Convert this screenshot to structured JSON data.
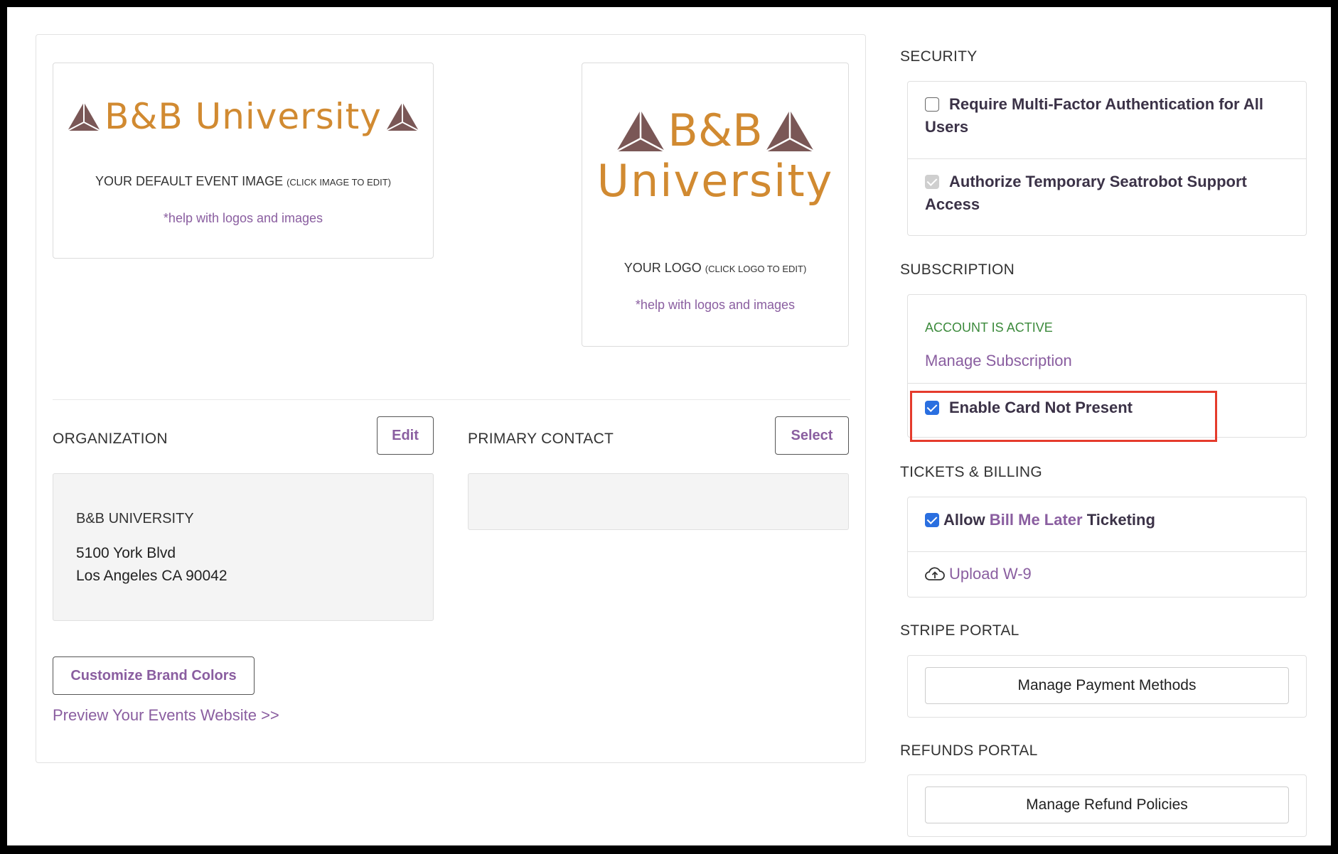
{
  "brand": {
    "wide_text": "B&B University",
    "stack_line1": "B&B",
    "stack_line2": "University",
    "colors": {
      "text": "#d18a31",
      "triangle": "#7a5756",
      "accent": "#8a5ea0",
      "highlight": "#e53b2c"
    }
  },
  "event_image": {
    "caption": "YOUR DEFAULT EVENT IMAGE",
    "caption_hint": "(CLICK IMAGE TO EDIT)",
    "help": "*help with logos and images"
  },
  "logo": {
    "caption": "YOUR LOGO",
    "caption_hint": "(CLICK LOGO TO EDIT)",
    "help": "*help with logos and images"
  },
  "organization": {
    "label": "ORGANIZATION",
    "edit_label": "Edit",
    "name": "B&B UNIVERSITY",
    "address_line1": "5100 York Blvd",
    "address_line2": "Los Angeles CA 90042"
  },
  "primary_contact": {
    "label": "PRIMARY CONTACT",
    "select_label": "Select"
  },
  "customize_label": "Customize Brand Colors",
  "preview_link": "Preview Your Events Website >>",
  "security": {
    "label": "SECURITY",
    "mfa_label": "Require Multi-Factor Authentication for All Users",
    "mfa_checked": false,
    "support_label": "Authorize Temporary Seatrobot Support Access",
    "support_checked": true
  },
  "subscription": {
    "label": "SUBSCRIPTION",
    "status": "ACCOUNT IS ACTIVE",
    "manage_link": "Manage Subscription",
    "cnp_label": "Enable Card Not Present",
    "cnp_checked": true
  },
  "tickets": {
    "label": "TICKETS & BILLING",
    "allow_prefix": "Allow",
    "allow_link": "Bill Me Later",
    "allow_suffix": "Ticketing",
    "allow_checked": true,
    "upload_label": "Upload W-9"
  },
  "stripe": {
    "label": "STRIPE PORTAL",
    "button": "Manage Payment Methods"
  },
  "refunds": {
    "label": "REFUNDS PORTAL",
    "button": "Manage Refund Policies"
  }
}
